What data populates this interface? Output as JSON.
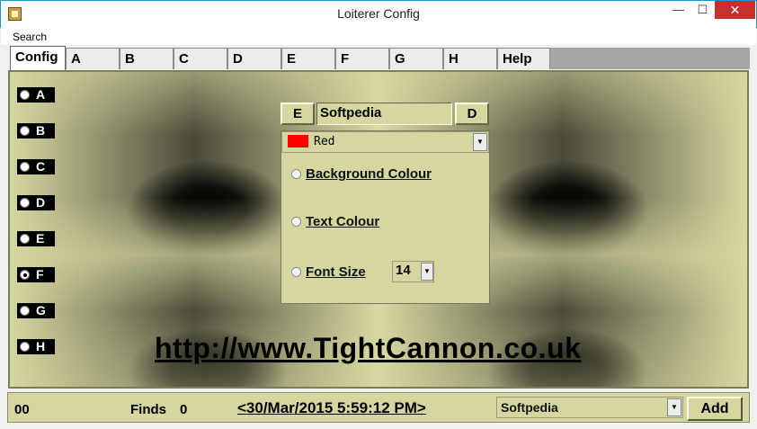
{
  "window": {
    "title": "Loiterer Config",
    "minimize": "—",
    "maximize": "☐",
    "close": "✕"
  },
  "menu": {
    "search": "Search"
  },
  "tabs": [
    "Config",
    "A",
    "B",
    "C",
    "D",
    "E",
    "F",
    "G",
    "H",
    "Help"
  ],
  "side_radios": [
    {
      "label": "A",
      "selected": false
    },
    {
      "label": "B",
      "selected": false
    },
    {
      "label": "C",
      "selected": false
    },
    {
      "label": "D",
      "selected": false
    },
    {
      "label": "E",
      "selected": false
    },
    {
      "label": "F",
      "selected": true
    },
    {
      "label": "G",
      "selected": false
    },
    {
      "label": "H",
      "selected": false
    }
  ],
  "dialog": {
    "e_button": "E",
    "d_button": "D",
    "name_value": "Softpedia",
    "colour_value": "Red",
    "colour_swatch": "#ff0000",
    "options": {
      "background": "Background Colour",
      "text": "Text Colour",
      "font_size": "Font Size"
    },
    "font_size_value": "14"
  },
  "url": "http://www.TightCannon.co.uk",
  "status": {
    "counter": "00",
    "finds_label": "Finds",
    "finds_count": "0",
    "datetime": "<30/Mar/2015 5:59:12 PM>",
    "site_value": "Softpedia",
    "add_label": "Add"
  },
  "colors": {
    "panel_bg": "#d6d6a0",
    "title_accent": "#1e90d6",
    "close_red": "#c7312d"
  },
  "icons": {
    "dropdown": "▼"
  }
}
